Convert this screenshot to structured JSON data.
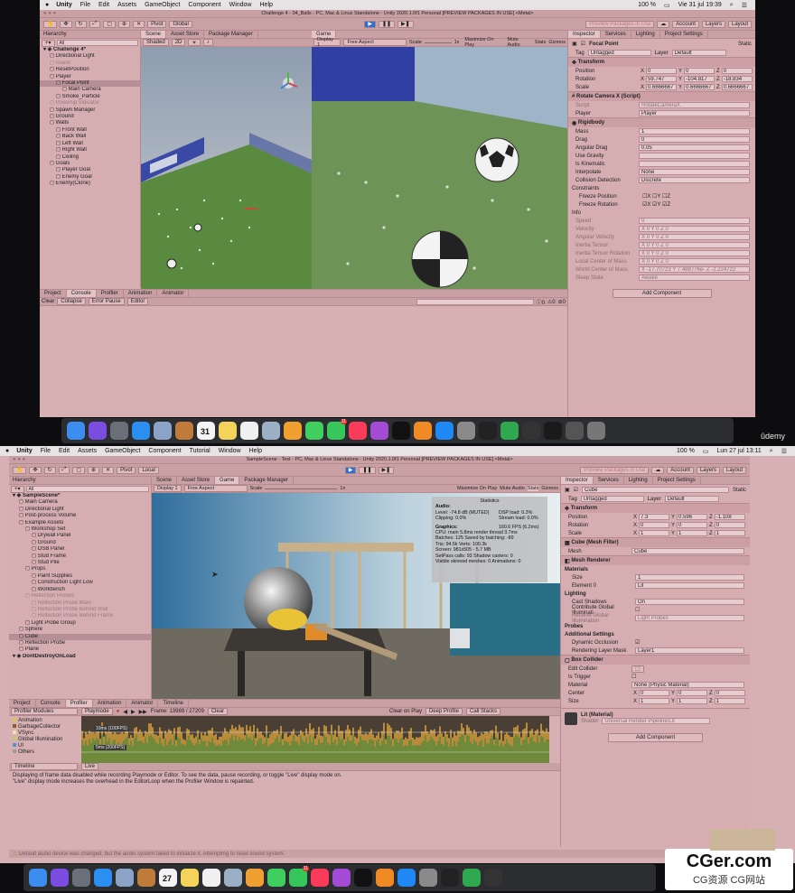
{
  "top": {
    "menubar": {
      "app": "Unity",
      "items": [
        "File",
        "Edit",
        "Assets",
        "GameObject",
        "Component",
        "Window",
        "Help"
      ],
      "battery": "100 %",
      "datetime": "Vie 31 jul 19:39"
    },
    "title": "Challenge 4 - 04_Balls - PC, Mac & Linux Standalone - Unity 2020.1.0f1 Personal [PREVIEW PACKAGES IN USE] <Metal>",
    "toolbar": {
      "pivot": "Pivot",
      "global": "Global",
      "preview_packages": "Preview Packages in Use",
      "account": "Account",
      "layers": "Layers",
      "layout": "Layout"
    },
    "hierarchy": {
      "tab": "Hierarchy",
      "search_placeholder": "All",
      "items": [
        {
          "label": "Challenge 4*",
          "depth": 0
        },
        {
          "label": "Directional Light",
          "depth": 1
        },
        {
          "label": "Island",
          "depth": 1,
          "dim": true
        },
        {
          "label": "ResetPosition",
          "depth": 1
        },
        {
          "label": "Player",
          "depth": 1
        },
        {
          "label": "Focal Point",
          "depth": 2,
          "selected": true
        },
        {
          "label": "Main Camera",
          "depth": 3
        },
        {
          "label": "Smoke_Particle",
          "depth": 2
        },
        {
          "label": "Powerup Indicator",
          "depth": 1,
          "dim": true
        },
        {
          "label": "Spawn Manager",
          "depth": 1
        },
        {
          "label": "Ground",
          "depth": 1
        },
        {
          "label": "Walls",
          "depth": 1
        },
        {
          "label": "Front Wall",
          "depth": 2
        },
        {
          "label": "Back Wall",
          "depth": 2
        },
        {
          "label": "Left Wall",
          "depth": 2
        },
        {
          "label": "Right Wall",
          "depth": 2
        },
        {
          "label": "Ceiling",
          "depth": 2
        },
        {
          "label": "Goals",
          "depth": 1
        },
        {
          "label": "Player Goal",
          "depth": 2
        },
        {
          "label": "Enemy Goal",
          "depth": 2
        },
        {
          "label": "Enemy(Clone)",
          "depth": 1
        }
      ]
    },
    "scene": {
      "tab": "Scene",
      "asset_store": "Asset Store",
      "package_manager": "Package Manager",
      "shaded": "Shaded",
      "mode": "2D"
    },
    "game": {
      "tab": "Game",
      "display": "Display 1",
      "aspect": "Free Aspect",
      "scale_label": "Scale",
      "scale_value": "1x",
      "maximize": "Maximize On Play",
      "mute": "Mute Audio",
      "stats": "Stats",
      "gizmos": "Gizmos"
    },
    "console": {
      "tabs": [
        "Project",
        "Console",
        "Profiler",
        "Animation",
        "Animator"
      ],
      "buttons": [
        "Clear",
        "Collapse",
        "Error Pause",
        "Editor"
      ]
    },
    "inspector": {
      "tabs": [
        "Inspector",
        "Services",
        "Lighting",
        "Project Settings"
      ],
      "object_name": "Focal Point",
      "static": "Static",
      "tag_label": "Tag",
      "tag": "Untagged",
      "layer_label": "Layer",
      "layer": "Default",
      "transform": {
        "title": "Transform",
        "position": {
          "label": "Position",
          "x": "0",
          "y": "0",
          "z": "0"
        },
        "rotation": {
          "label": "Rotation",
          "x": "59.747",
          "y": "-104.817",
          "z": "-18.834"
        },
        "scale": {
          "label": "Scale",
          "x": "0.6666667",
          "y": "0.6666667",
          "z": "0.6666667"
        }
      },
      "script_comp": {
        "title": "Rotate Camera X (Script)",
        "script_label": "Script",
        "script": "RotateCameraX",
        "player_label": "Player",
        "player": "Player"
      },
      "rigidbody": {
        "title": "Rigidbody",
        "props": [
          {
            "k": "Mass",
            "v": "1"
          },
          {
            "k": "Drag",
            "v": "0"
          },
          {
            "k": "Angular Drag",
            "v": "0.05"
          },
          {
            "k": "Use Gravity",
            "v": ""
          },
          {
            "k": "Is Kinematic",
            "v": ""
          },
          {
            "k": "Interpolate",
            "v": "None"
          },
          {
            "k": "Collision Detection",
            "v": "Discrete"
          }
        ],
        "constraints": "Constraints",
        "freeze_position": "Freeze Position",
        "freeze_rotation": "Freeze Rotation",
        "info": "Info",
        "info_props": [
          {
            "k": "Speed",
            "v": "0"
          },
          {
            "k": "Velocity",
            "v": "X 0   Y 0   Z 0"
          },
          {
            "k": "Angular Velocity",
            "v": "X 0   Y 0   Z 0"
          },
          {
            "k": "Inertia Tensor",
            "v": "X 0   Y 0   Z 0"
          },
          {
            "k": "Inertia Tensor Rotation",
            "v": "X 0   Y 0   Z 0"
          },
          {
            "k": "Local Center of Mass",
            "v": "X 0   Y 0   Z 0"
          },
          {
            "k": "World Center of Mass",
            "v": "X -17.70723  Y 7.488776e-  Z -2.224722"
          },
          {
            "k": "Sleep State",
            "v": "Awake"
          }
        ]
      },
      "add_component": "Add Component"
    }
  },
  "bottom": {
    "menubar": {
      "app": "Unity",
      "items": [
        "File",
        "Edit",
        "Assets",
        "GameObject",
        "Component",
        "Tutorial",
        "Window",
        "Help"
      ],
      "battery": "100 %",
      "datetime": "Lun 27 jul 13:11"
    },
    "title": "SampleScene - Test - PC, Mac & Linux Standalone - Unity 2020.1.0f1 Personal [PREVIEW PACKAGES IN USE] <Metal>",
    "toolbar": {
      "pivot": "Pivot",
      "local": "Local",
      "preview_packages": "Preview Packages in Use",
      "account": "Account",
      "layers": "Layers",
      "layout": "Layout"
    },
    "hierarchy": {
      "tab": "Hierarchy",
      "search_placeholder": "All",
      "items": [
        {
          "label": "SampleScene*",
          "depth": 0
        },
        {
          "label": "Main Camera",
          "depth": 1
        },
        {
          "label": "Directional Light",
          "depth": 1
        },
        {
          "label": "Post-process Volume",
          "depth": 1
        },
        {
          "label": "Example Assets",
          "depth": 1
        },
        {
          "label": "Workshop Set",
          "depth": 2
        },
        {
          "label": "Drywall Panel",
          "depth": 3
        },
        {
          "label": "Ground",
          "depth": 3
        },
        {
          "label": "OSB Panel",
          "depth": 3
        },
        {
          "label": "Stud Frame",
          "depth": 3
        },
        {
          "label": "Stud Pile",
          "depth": 3
        },
        {
          "label": "Props",
          "depth": 2
        },
        {
          "label": "Paint Supplies",
          "depth": 3
        },
        {
          "label": "Construction Light Low",
          "depth": 3
        },
        {
          "label": "Workbench",
          "depth": 3
        },
        {
          "label": "Reflection Probes",
          "depth": 2,
          "dim": true
        },
        {
          "label": "Reflection Probe Main",
          "depth": 3,
          "dim": true
        },
        {
          "label": "Reflection Probe Behind Wall",
          "depth": 3,
          "dim": true
        },
        {
          "label": "Reflection Probe Behind Frame",
          "depth": 3,
          "dim": true
        },
        {
          "label": "Light Probe Group",
          "depth": 2
        },
        {
          "label": "Sphere",
          "depth": 1
        },
        {
          "label": "Cube",
          "depth": 1,
          "selected": true
        },
        {
          "label": "Reflection Probe",
          "depth": 1
        },
        {
          "label": "Plane",
          "depth": 1
        },
        {
          "label": "DontDestroyOnLoad",
          "depth": 0
        }
      ]
    },
    "scene": {
      "tab": "Scene",
      "asset_store": "Asset Store",
      "game_tab": "Game",
      "package_manager": "Package Manager"
    },
    "game": {
      "display": "Display 1",
      "aspect": "Free Aspect",
      "scale_label": "Scale",
      "scale_value": "1x",
      "maximize": "Maximize On Play",
      "mute": "Mute Audio",
      "stats": "Stats",
      "gizmos": "Gizmos"
    },
    "statistics": {
      "title": "Statistics",
      "audio_label": "Audio:",
      "level": "Level: -74.8 dB (MUTED)",
      "clipping": "Clipping: 0.0%",
      "dsp": "DSP load: 0.3%",
      "stream": "Stream load: 0.0%",
      "graphics_label": "Graphics:",
      "fps": "160.6 FPS (6.2ms)",
      "lines": [
        "CPU: main 5.8ms  render thread 3.7ms",
        "Batches: 125    Saved by batching: -89",
        "Tris: 94.5k     Verts: 100.3k",
        "Screen: 981x505 - 5.7 MB",
        "SetPass calls: 93    Shadow casters: 0",
        "Visible skinned meshes: 0   Animations: 0"
      ]
    },
    "inspector": {
      "tabs": [
        "Inspector",
        "Services",
        "Lighting",
        "Project Settings"
      ],
      "object_name": "Cube",
      "static": "Static",
      "tag_label": "Tag",
      "tag": "Untagged",
      "layer_label": "Layer",
      "layer": "Default",
      "transform": {
        "title": "Transform",
        "position": {
          "label": "Position",
          "x": "7.3",
          "y": "0.596",
          "z": "-1.108"
        },
        "rotation": {
          "label": "Rotation",
          "x": "0",
          "y": "0",
          "z": "0"
        },
        "scale": {
          "label": "Scale",
          "x": "1",
          "y": "1",
          "z": "1"
        }
      },
      "mesh_filter": {
        "title": "Cube (Mesh Filter)",
        "mesh_label": "Mesh",
        "mesh": "Cube"
      },
      "mesh_renderer": {
        "title": "Mesh Renderer",
        "materials": "Materials",
        "size_label": "Size",
        "size": "1",
        "element_label": "Element 0",
        "element": "Lit",
        "lighting": "Lighting",
        "cast_shadows_label": "Cast Shadows",
        "cast_shadows": "On",
        "contribute_gi": "Contribute Global Illuminati",
        "receive_gi": "Receive Global Illumination",
        "receive_gi_value": "Light Probes",
        "probes": "Probes",
        "additional": "Additional Settings",
        "dynamic_occlusion": "Dynamic Occlusion",
        "rendering_layer_label": "Rendering Layer Mask",
        "rendering_layer": "Layer1"
      },
      "box_collider": {
        "title": "Box Collider",
        "edit_collider": "Edit Collider",
        "is_trigger": "Is Trigger",
        "material_label": "Material",
        "material": "None (Physic Material)",
        "center_label": "Center",
        "center": {
          "x": "0",
          "y": "0",
          "z": "0"
        },
        "size_label": "Size",
        "size": {
          "x": "1",
          "y": "1",
          "z": "1"
        }
      },
      "material_preview": {
        "name": "Lit (Material)",
        "shader_label": "Shader",
        "shader": "Universal Render Pipeline/Lit"
      },
      "add_component": "Add Component"
    },
    "profiler": {
      "tabs": [
        "Project",
        "Console",
        "Profiler",
        "Animation",
        "Animator",
        "Timeline"
      ],
      "modules_label": "Profiler Modules",
      "playmode": "Playmode",
      "frame": "Frame: 13989 / 27209",
      "clear": "Clear",
      "clear_on_play": "Clear on Play",
      "deep_profile": "Deep Profile",
      "call_stacks": "Call Stacks",
      "modules": [
        "Animation",
        "GarbageCollector",
        "VSync",
        "Global Illumination",
        "UI",
        "Others"
      ],
      "marker_10ms": "10ms (100FPS)",
      "marker_5ms": "5ms (200FPS)",
      "timeline": "Timeline",
      "live": "Live",
      "message1": "Displaying of frame data disabled while recording Playmode or Editor. To see the data, pause recording, or toggle \"Live\" display mode on.",
      "message2": "\"Live\" display mode increases the overhead in the EditorLoop when the Profiler Window is repainted."
    },
    "status_bar": "Default audio device was changed, but the audio system failed to initialize it. Attempting to reset sound system."
  },
  "watermarks": {
    "udemy": "ûdemy",
    "cger": "CGer.com",
    "cger_sub": "CG资源 CG网站"
  },
  "dock_badges": {
    "calendar_top": "31",
    "calendar_bottom": "27",
    "facetime": "11"
  }
}
